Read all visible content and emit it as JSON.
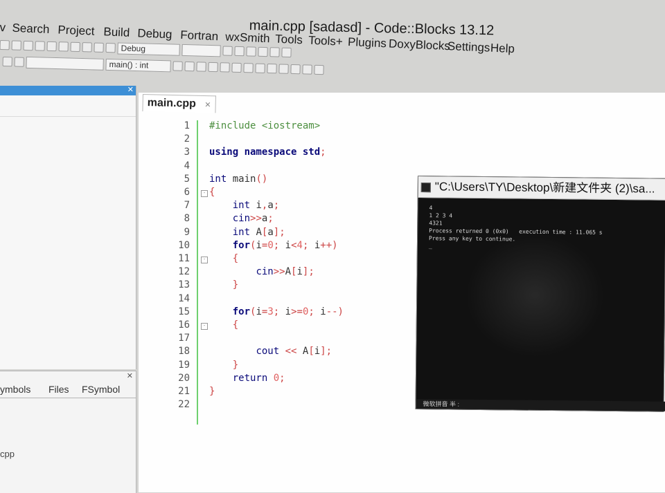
{
  "window": {
    "title": "main.cpp [sadasd] - Code::Blocks 13.12"
  },
  "menu": [
    "v",
    "Search",
    "Project",
    "Build",
    "Debug",
    "Fortran",
    "wxSmith",
    "Tools",
    "Tools+",
    "Plugins",
    "DoxyBlocks",
    "Settings",
    "Help"
  ],
  "toolbar": {
    "build_target": "Debug",
    "function_combo": "main() : int"
  },
  "bottom_panel": {
    "tabs": [
      "ymbols",
      "Files",
      "FSymbol"
    ],
    "item": "cpp"
  },
  "editor": {
    "tab_label": "main.cpp",
    "lines": [
      {
        "n": "1",
        "html": "<span class=\"pp\">#include &lt;iostream&gt;</span>"
      },
      {
        "n": "2",
        "html": ""
      },
      {
        "n": "3",
        "html": "<span class=\"kw\">using namespace</span> <span class=\"kw\">std</span><span class=\"sym\">;</span>"
      },
      {
        "n": "4",
        "html": ""
      },
      {
        "n": "5",
        "html": "<span class=\"kw2\">int</span> <span class=\"plain\">main</span><span class=\"sym\">()</span>"
      },
      {
        "n": "6",
        "html": "<span class=\"sym\">{</span>"
      },
      {
        "n": "7",
        "html": "    <span class=\"kw2\">int</span> <span class=\"plain\">i</span><span class=\"sym\">,</span><span class=\"plain\">a</span><span class=\"sym\">;</span>"
      },
      {
        "n": "8",
        "html": "    <span class=\"kw2\">cin</span><span class=\"sym\">&gt;&gt;</span><span class=\"plain\">a</span><span class=\"sym\">;</span>"
      },
      {
        "n": "9",
        "html": "    <span class=\"kw2\">int</span> <span class=\"plain\">A</span><span class=\"sym\">[</span><span class=\"plain\">a</span><span class=\"sym\">];</span>"
      },
      {
        "n": "10",
        "html": "    <span class=\"kw\">for</span><span class=\"sym\">(</span><span class=\"plain\">i</span><span class=\"sym\">=</span><span class=\"num\">0</span><span class=\"sym\">;</span> <span class=\"plain\">i</span><span class=\"sym\">&lt;</span><span class=\"num\">4</span><span class=\"sym\">;</span> <span class=\"plain\">i</span><span class=\"sym\">++)</span>"
      },
      {
        "n": "11",
        "html": "    <span class=\"sym\">{</span>"
      },
      {
        "n": "12",
        "html": "        <span class=\"kw2\">cin</span><span class=\"sym\">&gt;&gt;</span><span class=\"plain\">A</span><span class=\"sym\">[</span><span class=\"plain\">i</span><span class=\"sym\">];</span>"
      },
      {
        "n": "13",
        "html": "    <span class=\"sym\">}</span>"
      },
      {
        "n": "14",
        "html": ""
      },
      {
        "n": "15",
        "html": "    <span class=\"kw\">for</span><span class=\"sym\">(</span><span class=\"plain\">i</span><span class=\"sym\">=</span><span class=\"num\">3</span><span class=\"sym\">;</span> <span class=\"plain\">i</span><span class=\"sym\">&gt;=</span><span class=\"num\">0</span><span class=\"sym\">;</span> <span class=\"plain\">i</span><span class=\"sym\">--)</span>"
      },
      {
        "n": "16",
        "html": "    <span class=\"sym\">{</span>"
      },
      {
        "n": "17",
        "html": ""
      },
      {
        "n": "18",
        "html": "        <span class=\"kw2\">cout</span> <span class=\"sym\">&lt;&lt;</span> <span class=\"plain\">A</span><span class=\"sym\">[</span><span class=\"plain\">i</span><span class=\"sym\">];</span>"
      },
      {
        "n": "19",
        "html": "    <span class=\"sym\">}</span>"
      },
      {
        "n": "20",
        "html": "    <span class=\"kw2\">return</span> <span class=\"num\">0</span><span class=\"sym\">;</span>"
      },
      {
        "n": "21",
        "html": "<span class=\"sym\">}</span>"
      },
      {
        "n": "22",
        "html": ""
      }
    ]
  },
  "console": {
    "title": "\"C:\\Users\\TY\\Desktop\\新建文件夹 (2)\\sa...",
    "lines": [
      "4",
      "1 2 3 4",
      "4321",
      "Process returned 0 (0x0)   execution time : 11.065 s",
      "Press any key to continue.",
      "_"
    ],
    "status": "微软拼音 半 :"
  }
}
